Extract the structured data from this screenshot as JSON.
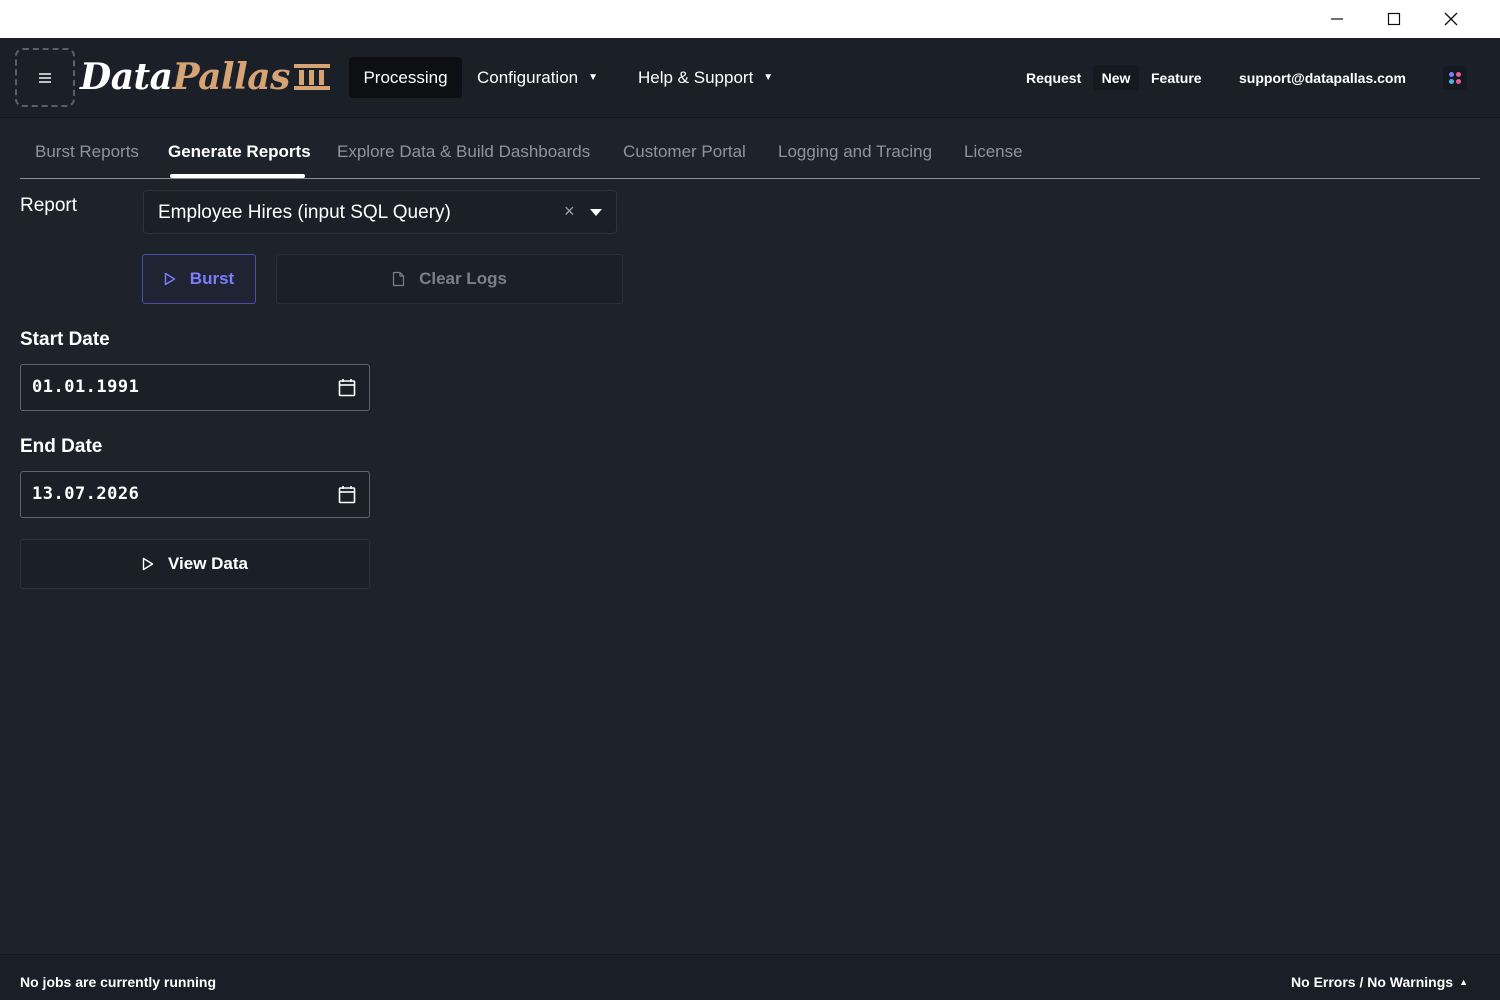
{
  "window": {
    "controls": [
      "minimize",
      "maximize",
      "close"
    ]
  },
  "header": {
    "menu_icon": "hamburger-icon",
    "logo_data": "Data",
    "logo_pallas": "Pallas",
    "nav": {
      "processing": "Processing",
      "configuration": "Configuration",
      "help_support": "Help & Support"
    },
    "request": "Request",
    "new": "New",
    "feature": "Feature",
    "support_email": "support@datapallas.com",
    "accent_colors": [
      "#d6a374",
      "#7d7dfb"
    ]
  },
  "tabs": [
    {
      "label": "Burst Reports",
      "active": false
    },
    {
      "label": "Generate Reports",
      "active": true
    },
    {
      "label": "Explore Data & Build Dashboards",
      "active": false
    },
    {
      "label": "Customer Portal",
      "active": false
    },
    {
      "label": "Logging and Tracing",
      "active": false
    },
    {
      "label": "License",
      "active": false
    }
  ],
  "form": {
    "report_label": "Report",
    "report_value": "Employee Hires (input SQL Query)",
    "clear_symbol": "×",
    "burst_label": "Burst",
    "clear_logs_label": "Clear Logs",
    "start_date_label": "Start Date",
    "start_date_value": "01.01.1991",
    "end_date_label": "End Date",
    "end_date_value": "13.07.2026",
    "view_data_label": "View Data"
  },
  "statusbar": {
    "left": "No jobs are currently running",
    "right": "No Errors / No Warnings"
  }
}
